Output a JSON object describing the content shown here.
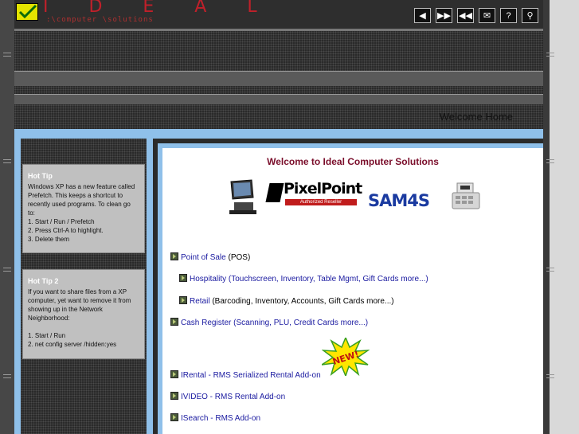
{
  "logo": {
    "letters": "I D E A L",
    "tagline": ":\\computer \\solutions"
  },
  "toolbar": [
    {
      "name": "volume-icon",
      "glyph": "◀"
    },
    {
      "name": "fast-forward-icon",
      "glyph": "▶▶"
    },
    {
      "name": "rewind-icon",
      "glyph": "◀◀"
    },
    {
      "name": "mail-icon",
      "glyph": "✉"
    },
    {
      "name": "help-icon",
      "glyph": "?"
    },
    {
      "name": "search-icon",
      "glyph": "⚲"
    }
  ],
  "header": {
    "welcome_home": "Welcome Home"
  },
  "tips": [
    {
      "title": "Hot Tip",
      "lines": [
        "Windows XP has a new feature called",
        "Prefetch. This keeps a shortcut to",
        "recently used programs. To clean go",
        "to:",
        "1. Start / Run / Prefetch",
        "2. Press Ctrl-A to highlight.",
        "3. Delete them"
      ]
    },
    {
      "title": "Hot Tip 2",
      "lines": [
        "If you want to share files from a XP",
        "computer, yet want to remove it from",
        "showing up in the Network",
        "Neighborhood:",
        "",
        "1. Start / Run",
        "2. net config server /hidden:yes"
      ]
    }
  ],
  "main": {
    "title": "Welcome to Ideal Computer Solutions",
    "logos": {
      "pixelpoint": "PixelPoint",
      "pixelpoint_sub": "Authorized Reseller",
      "sam4s": "SAM4S"
    },
    "new_badge": "NEW!",
    "links": [
      {
        "label": "Point of Sale",
        "rest": " (POS)"
      },
      {
        "label": "Hospitality (Touchscreen, Inventory, Table Mgmt, Gift Cards more...)",
        "rest": ""
      },
      {
        "label": "Retail",
        "rest": " (Barcoding, Inventory, Accounts, Gift Cards more...)"
      },
      {
        "label": "Cash Register (Scanning, PLU, Credit Cards more...)",
        "rest": ""
      },
      {
        "label": "IRental - RMS Serialized Rental Add-on",
        "rest": ""
      },
      {
        "label": "IVIDEO - RMS Rental Add-on",
        "rest": ""
      },
      {
        "label": "ISearch - RMS Add-on",
        "rest": ""
      }
    ]
  }
}
